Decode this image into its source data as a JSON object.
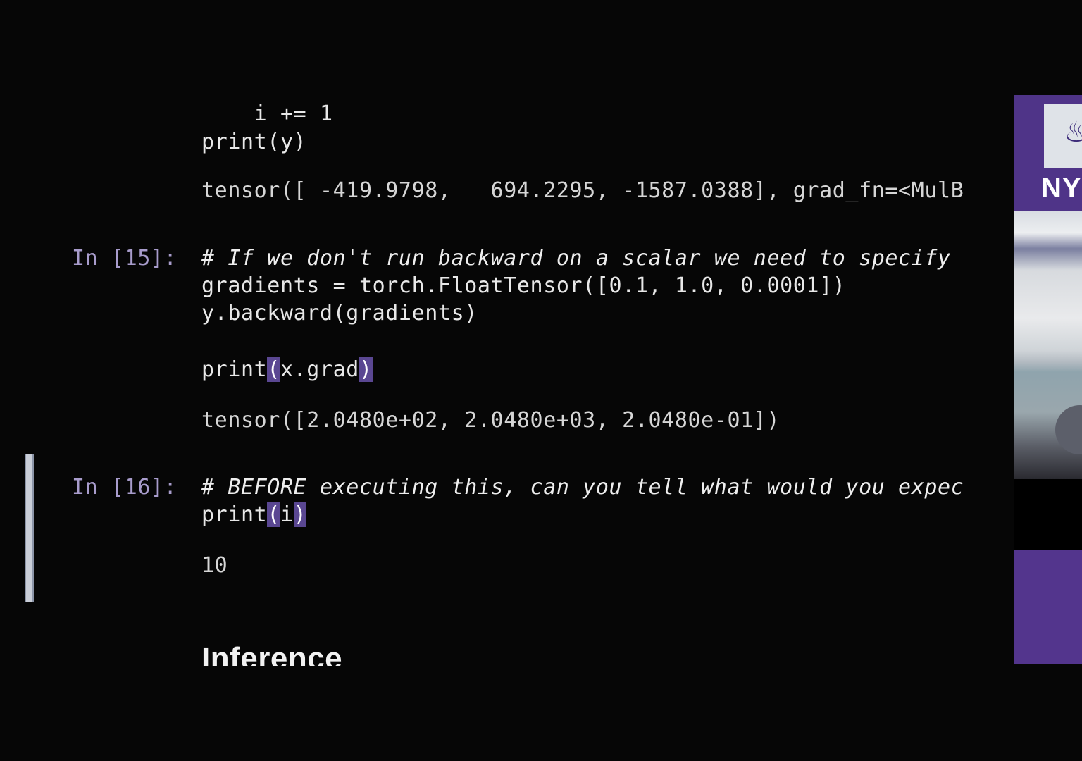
{
  "notebook": {
    "prev_cell": {
      "code_lines": [
        "    i += 1",
        "print(y)"
      ],
      "output": "tensor([ -419.9798,   694.2295, -1587.0388], grad_fn=<MulB"
    },
    "cell_15": {
      "prompt": "In [15]:",
      "comment": "# If we don't run backward on a scalar we need to specify",
      "line2": "gradients = torch.FloatTensor([0.1, 1.0, 0.0001])",
      "line3": "y.backward(gradients)",
      "line5_fn": "print",
      "line5_open": "(",
      "line5_arg": "x.grad",
      "line5_close": ")",
      "output": "tensor([2.0480e+02, 2.0480e+03, 2.0480e-01])"
    },
    "cell_16": {
      "prompt": "In [16]:",
      "comment": "# BEFORE executing this, can you tell what would you expec",
      "line2_fn": "print",
      "line2_open": "(",
      "line2_arg": "i",
      "line2_close": ")",
      "output": "10"
    },
    "section_heading": "Inference"
  },
  "video_overlay": {
    "logo_text": "NY",
    "brand_color": "#57068c"
  }
}
